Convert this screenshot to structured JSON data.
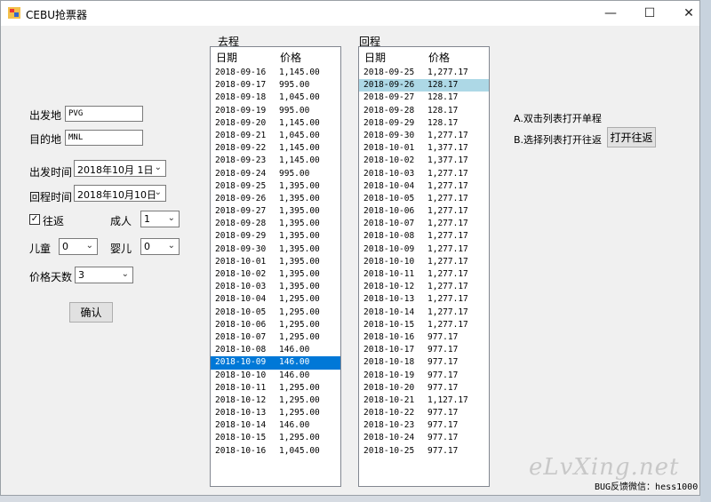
{
  "window": {
    "title": "CEBU抢票器"
  },
  "form": {
    "from_label": "出发地",
    "from_value": "PVG",
    "to_label": "目的地",
    "to_value": "MNL",
    "depart_label": "出发时间",
    "depart_value": "2018年10月 1日",
    "return_label": "回程时间",
    "return_value": "2018年10月10日",
    "roundtrip_label": "往返",
    "adult_label": "成人",
    "adult_value": "1",
    "child_label": "儿童",
    "child_value": "0",
    "infant_label": "婴儿",
    "infant_value": "0",
    "days_label": "价格天数",
    "days_value": "3",
    "confirm_label": "确认"
  },
  "outbound": {
    "label": "去程",
    "col_date": "日期",
    "col_price": "价格",
    "rows": [
      [
        "2018-09-16",
        "1,145.00"
      ],
      [
        "2018-09-17",
        "995.00"
      ],
      [
        "2018-09-18",
        "1,045.00"
      ],
      [
        "2018-09-19",
        "995.00"
      ],
      [
        "2018-09-20",
        "1,145.00"
      ],
      [
        "2018-09-21",
        "1,045.00"
      ],
      [
        "2018-09-22",
        "1,145.00"
      ],
      [
        "2018-09-23",
        "1,145.00"
      ],
      [
        "2018-09-24",
        "995.00"
      ],
      [
        "2018-09-25",
        "1,395.00"
      ],
      [
        "2018-09-26",
        "1,395.00"
      ],
      [
        "2018-09-27",
        "1,395.00"
      ],
      [
        "2018-09-28",
        "1,395.00"
      ],
      [
        "2018-09-29",
        "1,395.00"
      ],
      [
        "2018-09-30",
        "1,395.00"
      ],
      [
        "2018-10-01",
        "1,395.00"
      ],
      [
        "2018-10-02",
        "1,395.00"
      ],
      [
        "2018-10-03",
        "1,395.00"
      ],
      [
        "2018-10-04",
        "1,295.00"
      ],
      [
        "2018-10-05",
        "1,295.00"
      ],
      [
        "2018-10-06",
        "1,295.00"
      ],
      [
        "2018-10-07",
        "1,295.00"
      ],
      [
        "2018-10-08",
        "146.00"
      ],
      [
        "2018-10-09",
        "146.00"
      ],
      [
        "2018-10-10",
        "146.00"
      ],
      [
        "2018-10-11",
        "1,295.00"
      ],
      [
        "2018-10-12",
        "1,295.00"
      ],
      [
        "2018-10-13",
        "1,295.00"
      ],
      [
        "2018-10-14",
        "146.00"
      ],
      [
        "2018-10-15",
        "1,295.00"
      ],
      [
        "2018-10-16",
        "1,045.00"
      ]
    ],
    "selected_index": 23
  },
  "return_trip": {
    "label": "回程",
    "col_date": "日期",
    "col_price": "价格",
    "rows": [
      [
        "2018-09-25",
        "1,277.17"
      ],
      [
        "2018-09-26",
        "128.17"
      ],
      [
        "2018-09-27",
        "128.17"
      ],
      [
        "2018-09-28",
        "128.17"
      ],
      [
        "2018-09-29",
        "128.17"
      ],
      [
        "2018-09-30",
        "1,277.17"
      ],
      [
        "2018-10-01",
        "1,377.17"
      ],
      [
        "2018-10-02",
        "1,377.17"
      ],
      [
        "2018-10-03",
        "1,277.17"
      ],
      [
        "2018-10-04",
        "1,277.17"
      ],
      [
        "2018-10-05",
        "1,277.17"
      ],
      [
        "2018-10-06",
        "1,277.17"
      ],
      [
        "2018-10-07",
        "1,277.17"
      ],
      [
        "2018-10-08",
        "1,277.17"
      ],
      [
        "2018-10-09",
        "1,277.17"
      ],
      [
        "2018-10-10",
        "1,277.17"
      ],
      [
        "2018-10-11",
        "1,277.17"
      ],
      [
        "2018-10-12",
        "1,277.17"
      ],
      [
        "2018-10-13",
        "1,277.17"
      ],
      [
        "2018-10-14",
        "1,277.17"
      ],
      [
        "2018-10-15",
        "1,277.17"
      ],
      [
        "2018-10-16",
        "977.17"
      ],
      [
        "2018-10-17",
        "977.17"
      ],
      [
        "2018-10-18",
        "977.17"
      ],
      [
        "2018-10-19",
        "977.17"
      ],
      [
        "2018-10-20",
        "977.17"
      ],
      [
        "2018-10-21",
        "1,127.17"
      ],
      [
        "2018-10-22",
        "977.17"
      ],
      [
        "2018-10-23",
        "977.17"
      ],
      [
        "2018-10-24",
        "977.17"
      ],
      [
        "2018-10-25",
        "977.17"
      ]
    ],
    "selected_index": 1
  },
  "hints": {
    "single": "A.双击列表打开单程",
    "roundtrip": "B.选择列表打开往返",
    "open_roundtrip_button": "打开往返"
  },
  "footer": {
    "feedback": "BUG反馈微信：hess1000"
  },
  "watermark": "eLvXing.net"
}
